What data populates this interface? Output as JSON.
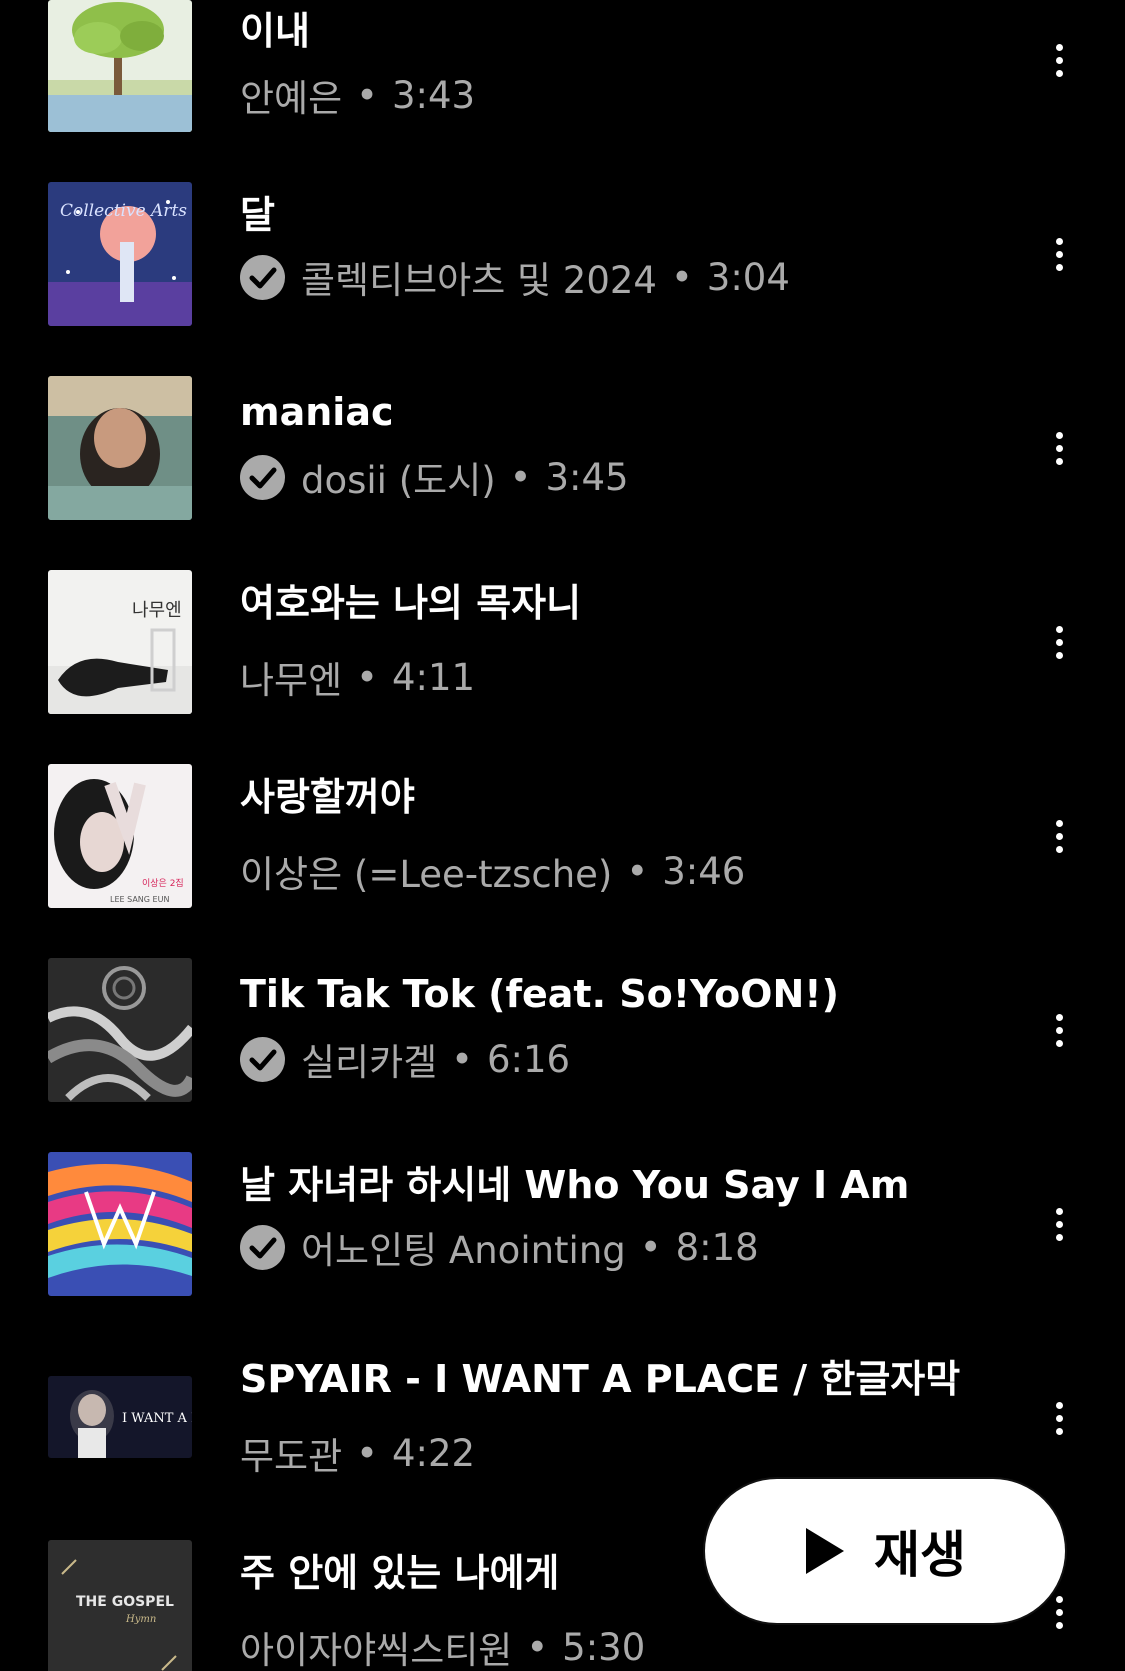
{
  "tracks": [
    {
      "title": "이내",
      "artist": "안예은",
      "duration": "3:43",
      "verified": false,
      "thumb_icon": "tree-artwork"
    },
    {
      "title": "달",
      "artist": "콜렉티브아츠 및 2024",
      "duration": "3:04",
      "verified": true,
      "thumb_icon": "moon-girl-artwork"
    },
    {
      "title": "maniac",
      "artist": "dosii (도시)",
      "duration": "3:45",
      "verified": true,
      "thumb_icon": "upside-down-face-artwork"
    },
    {
      "title": "여호와는 나의 목자니",
      "artist": "나무엔",
      "duration": "4:11",
      "verified": false,
      "thumb_icon": "guitar-case-artwork"
    },
    {
      "title": "사랑할꺼야",
      "artist": "이상은 (=Lee-tzsche)",
      "duration": "3:46",
      "verified": false,
      "thumb_icon": "portrait-artwork"
    },
    {
      "title": "Tik Tak Tok (feat. So!YoON!)",
      "artist": "실리카겔",
      "duration": "6:16",
      "verified": true,
      "thumb_icon": "monochrome-abstract-artwork"
    },
    {
      "title": "날 자녀라 하시네 Who You Say I Am",
      "artist": "어노인팅 Anointing",
      "duration": "8:18",
      "verified": true,
      "thumb_icon": "rainbow-w-artwork"
    },
    {
      "title": "SPYAIR - I WANT A PLACE / 한글자막",
      "artist": "무도관",
      "duration": "4:22",
      "verified": false,
      "thumb_icon": "video-thumbnail"
    },
    {
      "title": "주 안에 있는 나에게",
      "artist": "아이자야씩스티원",
      "duration": "5:30",
      "verified": false,
      "thumb_icon": "gospel-artwork"
    }
  ],
  "separator": "•",
  "art_text": {
    "t2": "Collective Arts",
    "t4": "나무엔",
    "t5": "이상은 2집",
    "t5b": "LEE SANG EUN",
    "t8": "I WANT A PL",
    "t9": "THE GOSPEL",
    "t9b": "Hymn"
  },
  "play_button": {
    "label": "재생"
  },
  "colors": {
    "background": "#000000",
    "title": "#ffffff",
    "subtitle": "#aaaaaa",
    "accent_button": "#ffffff"
  }
}
